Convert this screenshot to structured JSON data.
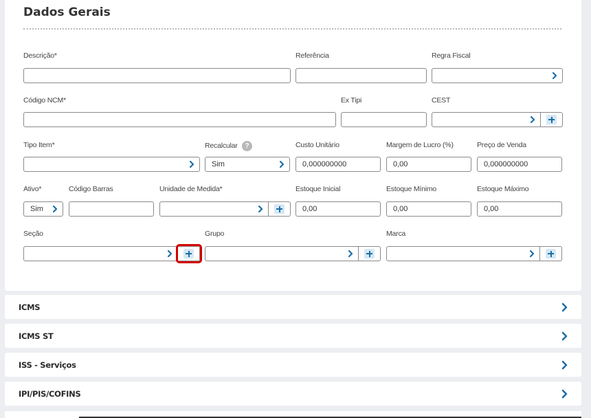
{
  "section": {
    "title": "Dados Gerais"
  },
  "fields": {
    "descricao": {
      "label": "Descrição*",
      "value": ""
    },
    "referencia": {
      "label": "Referência",
      "value": ""
    },
    "regra_fiscal": {
      "label": "Regra Fiscal",
      "value": ""
    },
    "codigo_ncm": {
      "label": "Código NCM*",
      "value": ""
    },
    "ex_tipi": {
      "label": "Ex Tipi",
      "value": ""
    },
    "cest": {
      "label": "CEST",
      "value": ""
    },
    "tipo_item": {
      "label": "Tipo Item*",
      "value": ""
    },
    "recalcular": {
      "label": "Recalcular",
      "value": "Sim",
      "help": "?"
    },
    "custo_unitario": {
      "label": "Custo Unitário",
      "value": "0,000000000"
    },
    "margem_lucro": {
      "label": "Margem de Lucro (%)",
      "value": "0,00"
    },
    "preco_venda": {
      "label": "Preço de Venda",
      "value": "0,000000000"
    },
    "ativo": {
      "label": "Ativo*",
      "value": "Sim"
    },
    "codigo_barras": {
      "label": "Código Barras",
      "value": ""
    },
    "unidade_medida": {
      "label": "Unidade de Medida*",
      "value": ""
    },
    "estoque_inicial": {
      "label": "Estoque Inicial",
      "value": "0,00"
    },
    "estoque_minimo": {
      "label": "Estoque Mínimo",
      "value": "0,00"
    },
    "estoque_maximo": {
      "label": "Estoque Máximo",
      "value": "0,00"
    },
    "secao": {
      "label": "Seção",
      "value": ""
    },
    "grupo": {
      "label": "Grupo",
      "value": ""
    },
    "marca": {
      "label": "Marca",
      "value": ""
    }
  },
  "accordions": [
    {
      "label": "ICMS"
    },
    {
      "label": "ICMS ST"
    },
    {
      "label": "ISS - Serviços"
    },
    {
      "label": "IPI/PIS/COFINS"
    }
  ],
  "colors": {
    "accent": "#1c6ea4",
    "highlight": "#d40000",
    "plus_bg": "#d6e7f5"
  },
  "icons": {
    "chevron": "chevron-right-icon",
    "plus": "plus-icon",
    "help": "help-icon"
  }
}
